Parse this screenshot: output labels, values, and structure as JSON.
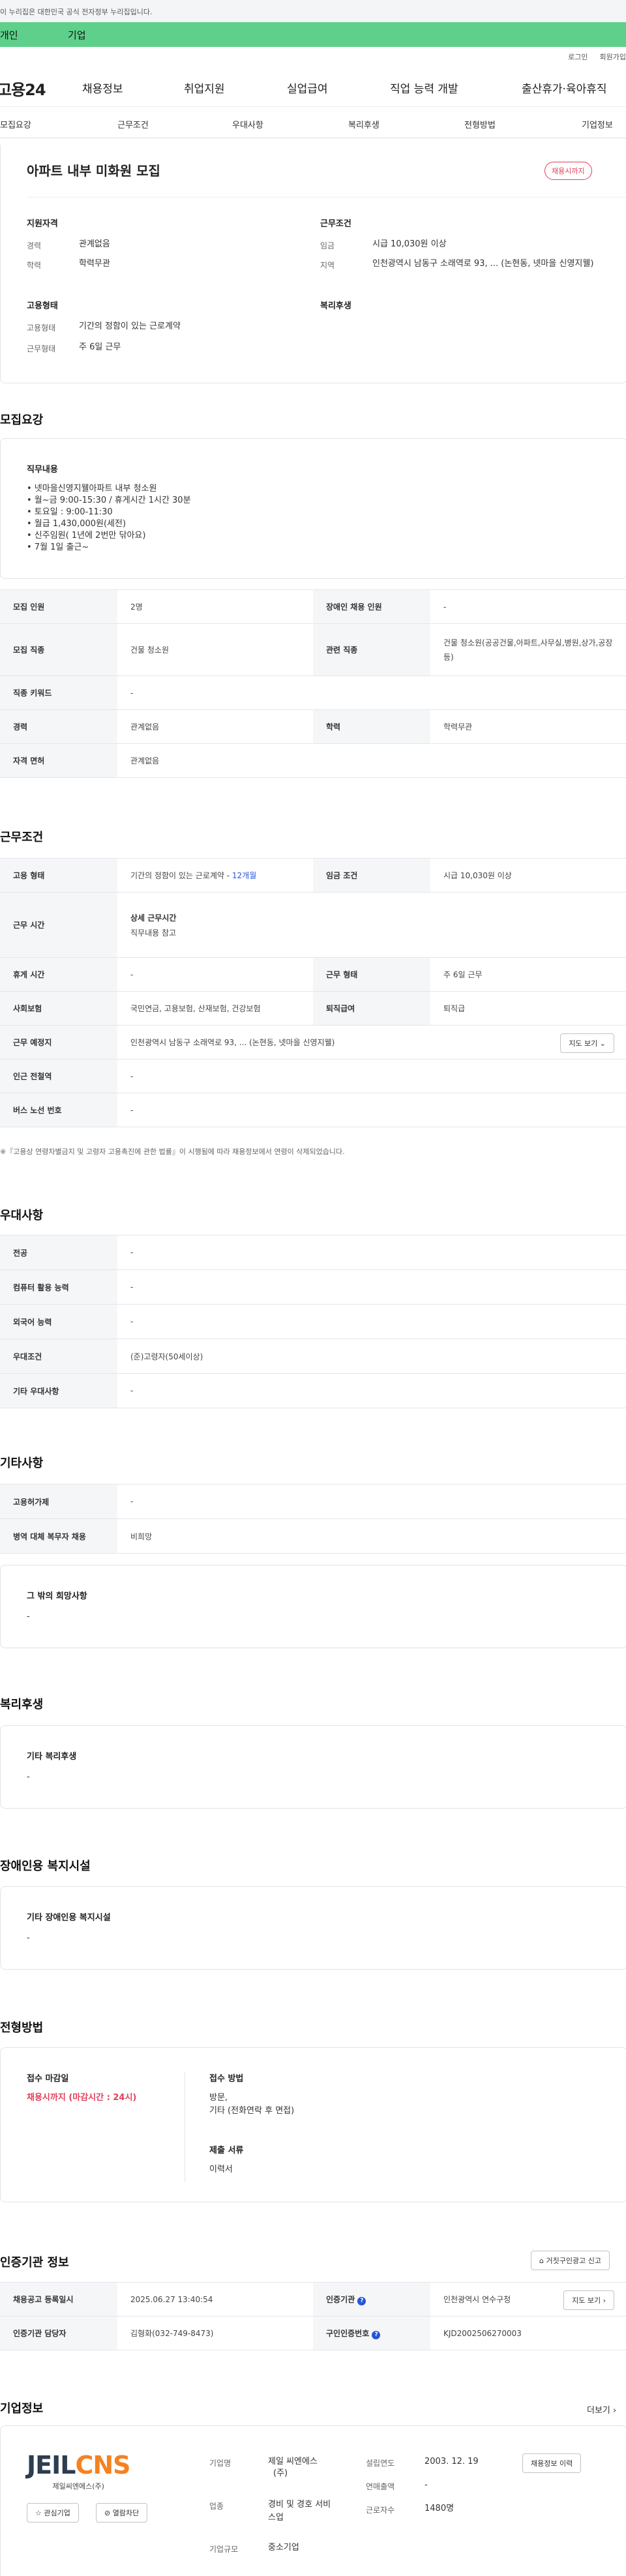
{
  "gov_banner": "이 누리집은 대한민국 공식 전자정부 누리집입니다.",
  "top_tabs": [
    "개인",
    "기업"
  ],
  "util": [
    "로그인",
    "회원가입"
  ],
  "logo": "고용24",
  "gnb": [
    "채용정보",
    "취업지원",
    "실업급여",
    "직업 능력 개발",
    "출산휴가·육아휴직"
  ],
  "subtabs": [
    "모집요강",
    "근무조건",
    "우대사항",
    "복리후생",
    "전형방법",
    "기업정보"
  ],
  "job": {
    "title": "아파트 내부 미화원 모집",
    "badge": "채용시까지",
    "qual_h": "지원자격",
    "qual": [
      {
        "k": "경력",
        "v": "관계없음"
      },
      {
        "k": "학력",
        "v": "학력무관"
      }
    ],
    "cond_h": "근무조건",
    "cond": [
      {
        "k": "임금",
        "v": "시급 10,030원 이상"
      },
      {
        "k": "지역",
        "v": "인천광역시 남동구 소래역로 93, ... (논현동, 넷마을 신영지웰)"
      }
    ],
    "emp_h": "고용형태",
    "emp": [
      {
        "k": "고용형태",
        "v": "기간의 정함이 있는 근로계약"
      },
      {
        "k": "근무형태",
        "v": "주 6일 근무"
      }
    ],
    "welfare_h": "복리후생"
  },
  "recruit": {
    "title": "모집요강",
    "duty_h": "직무내용",
    "duty_lines": [
      "• 넷마을신영지웰아파트 내부 청소원",
      "• 월~금 9:00-15:30 / 휴게시간 1시간 30분",
      "• 토요일 : 9:00-11:30",
      "• 월급 1,430,000원(세전)",
      "• 신주임원( 1년에 2번만 닦아요)",
      "• 7월 1일 출근~"
    ],
    "rows": [
      {
        "h1": "모집 인원",
        "v1": "2명",
        "h2": "장애인 채용 인원",
        "v2": "-"
      },
      {
        "h1": "모집 직종",
        "v1": "건물 청소원",
        "h2": "관련 직종",
        "v2": "건물 청소원(공공건물,아파트,사무실,병원,상가,공장 등)"
      },
      {
        "h1": "직종 키워드",
        "v1": "-"
      },
      {
        "h1": "경력",
        "v1": "관계없음",
        "h2": "학력",
        "v2": "학력무관"
      },
      {
        "h1": "자격 면허",
        "v1": "관계없음"
      }
    ]
  },
  "work": {
    "title": "근무조건",
    "emp_type_h": "고용 형태",
    "emp_type_v": "기간의 정함이 있는 근로계약 - ",
    "emp_type_link": "12개월",
    "wage_h": "임금 조건",
    "wage_v": "시급 10,030원 이상",
    "hours_h": "근무 시간",
    "hours_sub": "상세 근무시간",
    "hours_v": "직무내용 참고",
    "rest_h": "휴게 시간",
    "rest_v": "-",
    "form_h": "근무 형태",
    "form_v": "주 6일 근무",
    "ins_h": "사회보험",
    "ins_v": "국민연금, 고용보험, 산재보험, 건강보험",
    "retire_h": "퇴직급여",
    "retire_v": "퇴직급",
    "place_h": "근무 예정지",
    "place_v": "인천광역시 남동구 소래역로 93, ... (논현동, 넷마을 신영지웰)",
    "map_btn": "지도 보기",
    "subway_h": "인근 전철역",
    "subway_v": "-",
    "bus_h": "버스 노선 번호",
    "bus_v": "-",
    "note": "※『고용상 연령차별금지 및 고령자 고용촉진에 관한 법률』이 시행됨에 따라 채용정보에서 연령이 삭제되었습니다."
  },
  "pref": {
    "title": "우대사항",
    "rows": [
      {
        "h": "전공",
        "v": "-"
      },
      {
        "h": "컴퓨터 활용 능력",
        "v": "-"
      },
      {
        "h": "외국어 능력",
        "v": "-"
      },
      {
        "h": "우대조건",
        "v": "(준)고령자(50세이상)"
      },
      {
        "h": "기타 우대사항",
        "v": "-"
      }
    ]
  },
  "etc": {
    "title": "기타사항",
    "rows": [
      {
        "h": "고용허가제",
        "v": "-"
      },
      {
        "h": "병역 대체 복무자 채용",
        "v": "비희망"
      }
    ],
    "other_h": "그 밖의 희망사항",
    "other_v": "-"
  },
  "welfare": {
    "title": "복리후생",
    "h": "기타 복리후생",
    "v": "-"
  },
  "disabled": {
    "title": "장애인용 복지시설",
    "h": "기타 장애인용 복지시설",
    "v": "-"
  },
  "screening": {
    "title": "전형방법",
    "deadline_h": "접수 마감일",
    "deadline_v": "채용시까지 (마감시간 : 24시)",
    "method_h": "접수 방법",
    "method_v1": "방문,",
    "method_v2": "기타 (전화연락 후 면접)",
    "docs_h": "제출 서류",
    "docs_v": "이력서"
  },
  "cert": {
    "title": "인증기관 정보",
    "report_btn": "거짓구인광고 신고",
    "reg_h": "채용공고 등록일시",
    "reg_v": "2025.06.27 13:40:54",
    "org_h": "인증기관",
    "org_v": "인천광역시 연수구청",
    "mgr_h": "인증기관 담당자",
    "mgr_v": "김형화(032-749-8473)",
    "num_h": "구인인증번호",
    "num_v": "KJD2002506270003",
    "map_btn": "지도 보기"
  },
  "company": {
    "title": "기업정보",
    "more": "더보기",
    "logo_a": "JEIL",
    "logo_b": "CNS",
    "logo_sub": "제일씨엔에스(주)",
    "fav_btn": "관심기업",
    "block_btn": "열람차단",
    "f1_h": "기업명",
    "f1_v1": "제일 씨엔에스",
    "f1_v2": "(주)",
    "f2_h": "설립연도",
    "f2_v": "2003. 12. 19",
    "f3_h": "연매출액",
    "f3_v": "-",
    "f4_h": "업종",
    "f4_v1": "경비 및 경호 서비",
    "f4_v2": "스업",
    "f5_h": "근로자수",
    "f5_v": "1480명",
    "f6_h": "기업규모",
    "f6_v": "중소기업",
    "hist_btn": "채용정보 이력"
  },
  "colors": {
    "green": "#5fd08b",
    "accent_red": "#e43f59",
    "link_blue": "#2456d9",
    "logo_dark": "#2c3e50",
    "logo_orange": "#f58220"
  }
}
